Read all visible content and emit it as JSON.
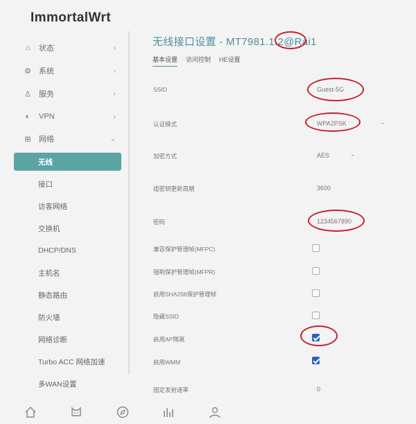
{
  "brand": "ImmortalWrt",
  "menu": [
    {
      "label": "状态",
      "icon": "home-icon"
    },
    {
      "label": "系统",
      "icon": "gear-icon"
    },
    {
      "label": "服务",
      "icon": "user-icon"
    },
    {
      "label": "VPN",
      "icon": "globe-icon"
    },
    {
      "label": "网络",
      "icon": "network-icon"
    }
  ],
  "submenu": [
    "无线",
    "接口",
    "访客网络",
    "交换机",
    "DHCP/DNS",
    "主机名",
    "静态路由",
    "防火墙",
    "网络诊断",
    "Turbo ACC 网络加速",
    "多WAN设置"
  ],
  "page": {
    "title": "无线接口设置 - MT7981.1.2@Rai1",
    "tabs": [
      "基本设置",
      "访问控制",
      "HE设置"
    ]
  },
  "fields": {
    "ssid": {
      "label": "SSID",
      "value": "Guest-5G"
    },
    "auth": {
      "label": "认证模式",
      "value": "WPA2PSK"
    },
    "enc": {
      "label": "加密方式",
      "value": "AES"
    },
    "rekey": {
      "label": "组密钥更新周期",
      "value": "3600"
    },
    "password": {
      "label": "密码",
      "value": "1234567890"
    },
    "mfpc": {
      "label": "兼容保护管理帧(MFPC)",
      "checked": false
    },
    "mfpr": {
      "label": "强制保护管理帧(MFPR)",
      "checked": false
    },
    "sha256": {
      "label": "启用SHA256保护管理帧",
      "checked": false
    },
    "hidden": {
      "label": "隐藏SSID",
      "checked": false
    },
    "apisolation": {
      "label": "启用AP隔离",
      "checked": true
    },
    "wmm": {
      "label": "启用WMM",
      "checked": true
    },
    "fixedrate": {
      "label": "固定发射速率",
      "value": "0"
    }
  },
  "colors": {
    "accent": "#5ba4a4",
    "title": "#4f8f9a",
    "annotation": "#c8202a",
    "checkbox": "#2c63b8"
  },
  "bottom_icons": [
    "home-icon",
    "cat-icon",
    "compass-icon",
    "chart-icon",
    "profile-icon"
  ]
}
